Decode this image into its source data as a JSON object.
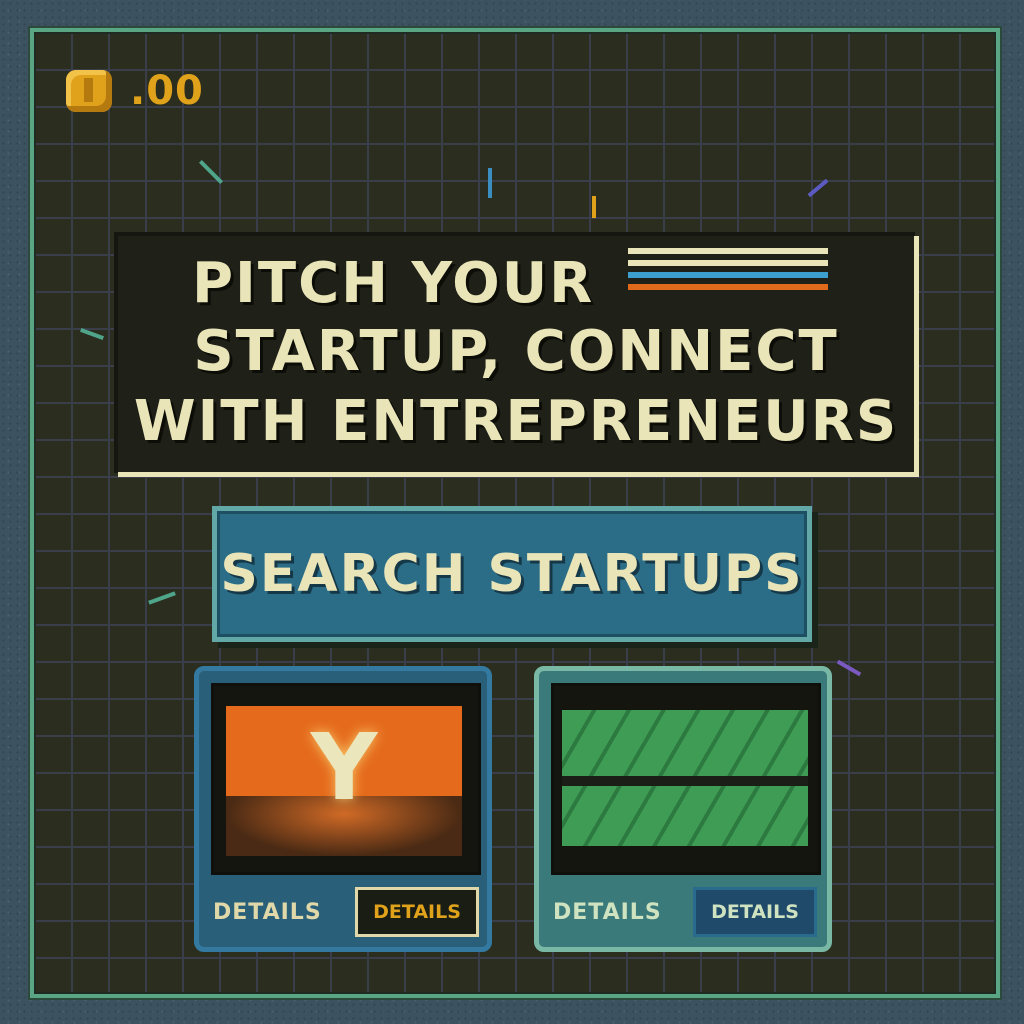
{
  "hud": {
    "coin_icon": "coin-icon",
    "coin_value": ".00"
  },
  "title": {
    "line1": "PITCH YOUR",
    "line2": "STARTUP, CONNECT",
    "line3": "WITH ENTREPRENEURS"
  },
  "search": {
    "label": "SEARCH STARTUPS"
  },
  "cards": [
    {
      "logo_text": "Y",
      "label": "DETAILS",
      "button": "DETAILS"
    },
    {
      "label": "DETAILS",
      "button": "DETAILS"
    }
  ],
  "colors": {
    "board": "#2b2d1f",
    "accent_gold": "#e0a21a",
    "text_cream": "#e9e5b8",
    "button_blue": "#2b6d86",
    "frame_green": "#5aa584"
  }
}
